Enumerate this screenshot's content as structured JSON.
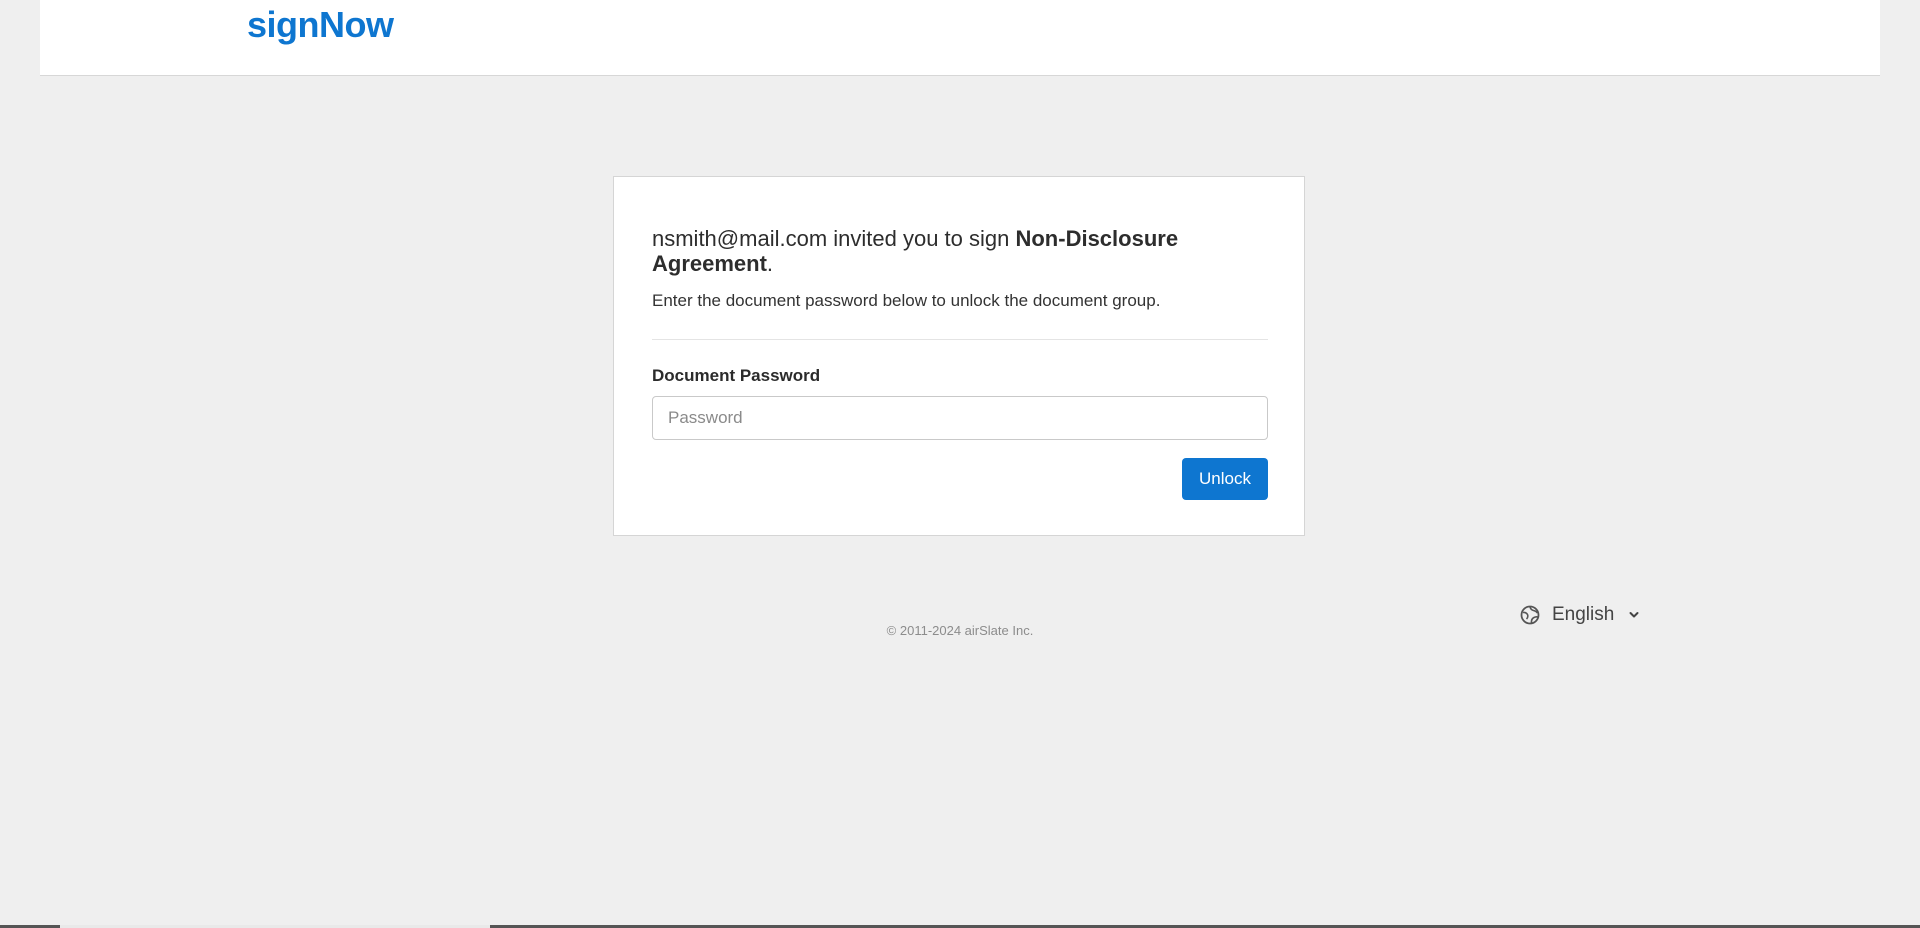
{
  "header": {
    "logo": "signNow"
  },
  "card": {
    "inviter": "nsmith@mail.com",
    "invite_mid": " invited you to sign ",
    "document_name": "Non-Disclosure Agreement",
    "invite_end": ".",
    "instruction": "Enter the document password below to unlock the document group.",
    "password_label": "Document Password",
    "password_placeholder": "Password",
    "password_value": "",
    "unlock_label": "Unlock"
  },
  "footer": {
    "copyright": "© 2011-2024 airSlate Inc."
  },
  "language": {
    "selected": "English",
    "icon": "globe-icon"
  },
  "colors": {
    "brand": "#0e76d0",
    "background": "#efefef"
  }
}
